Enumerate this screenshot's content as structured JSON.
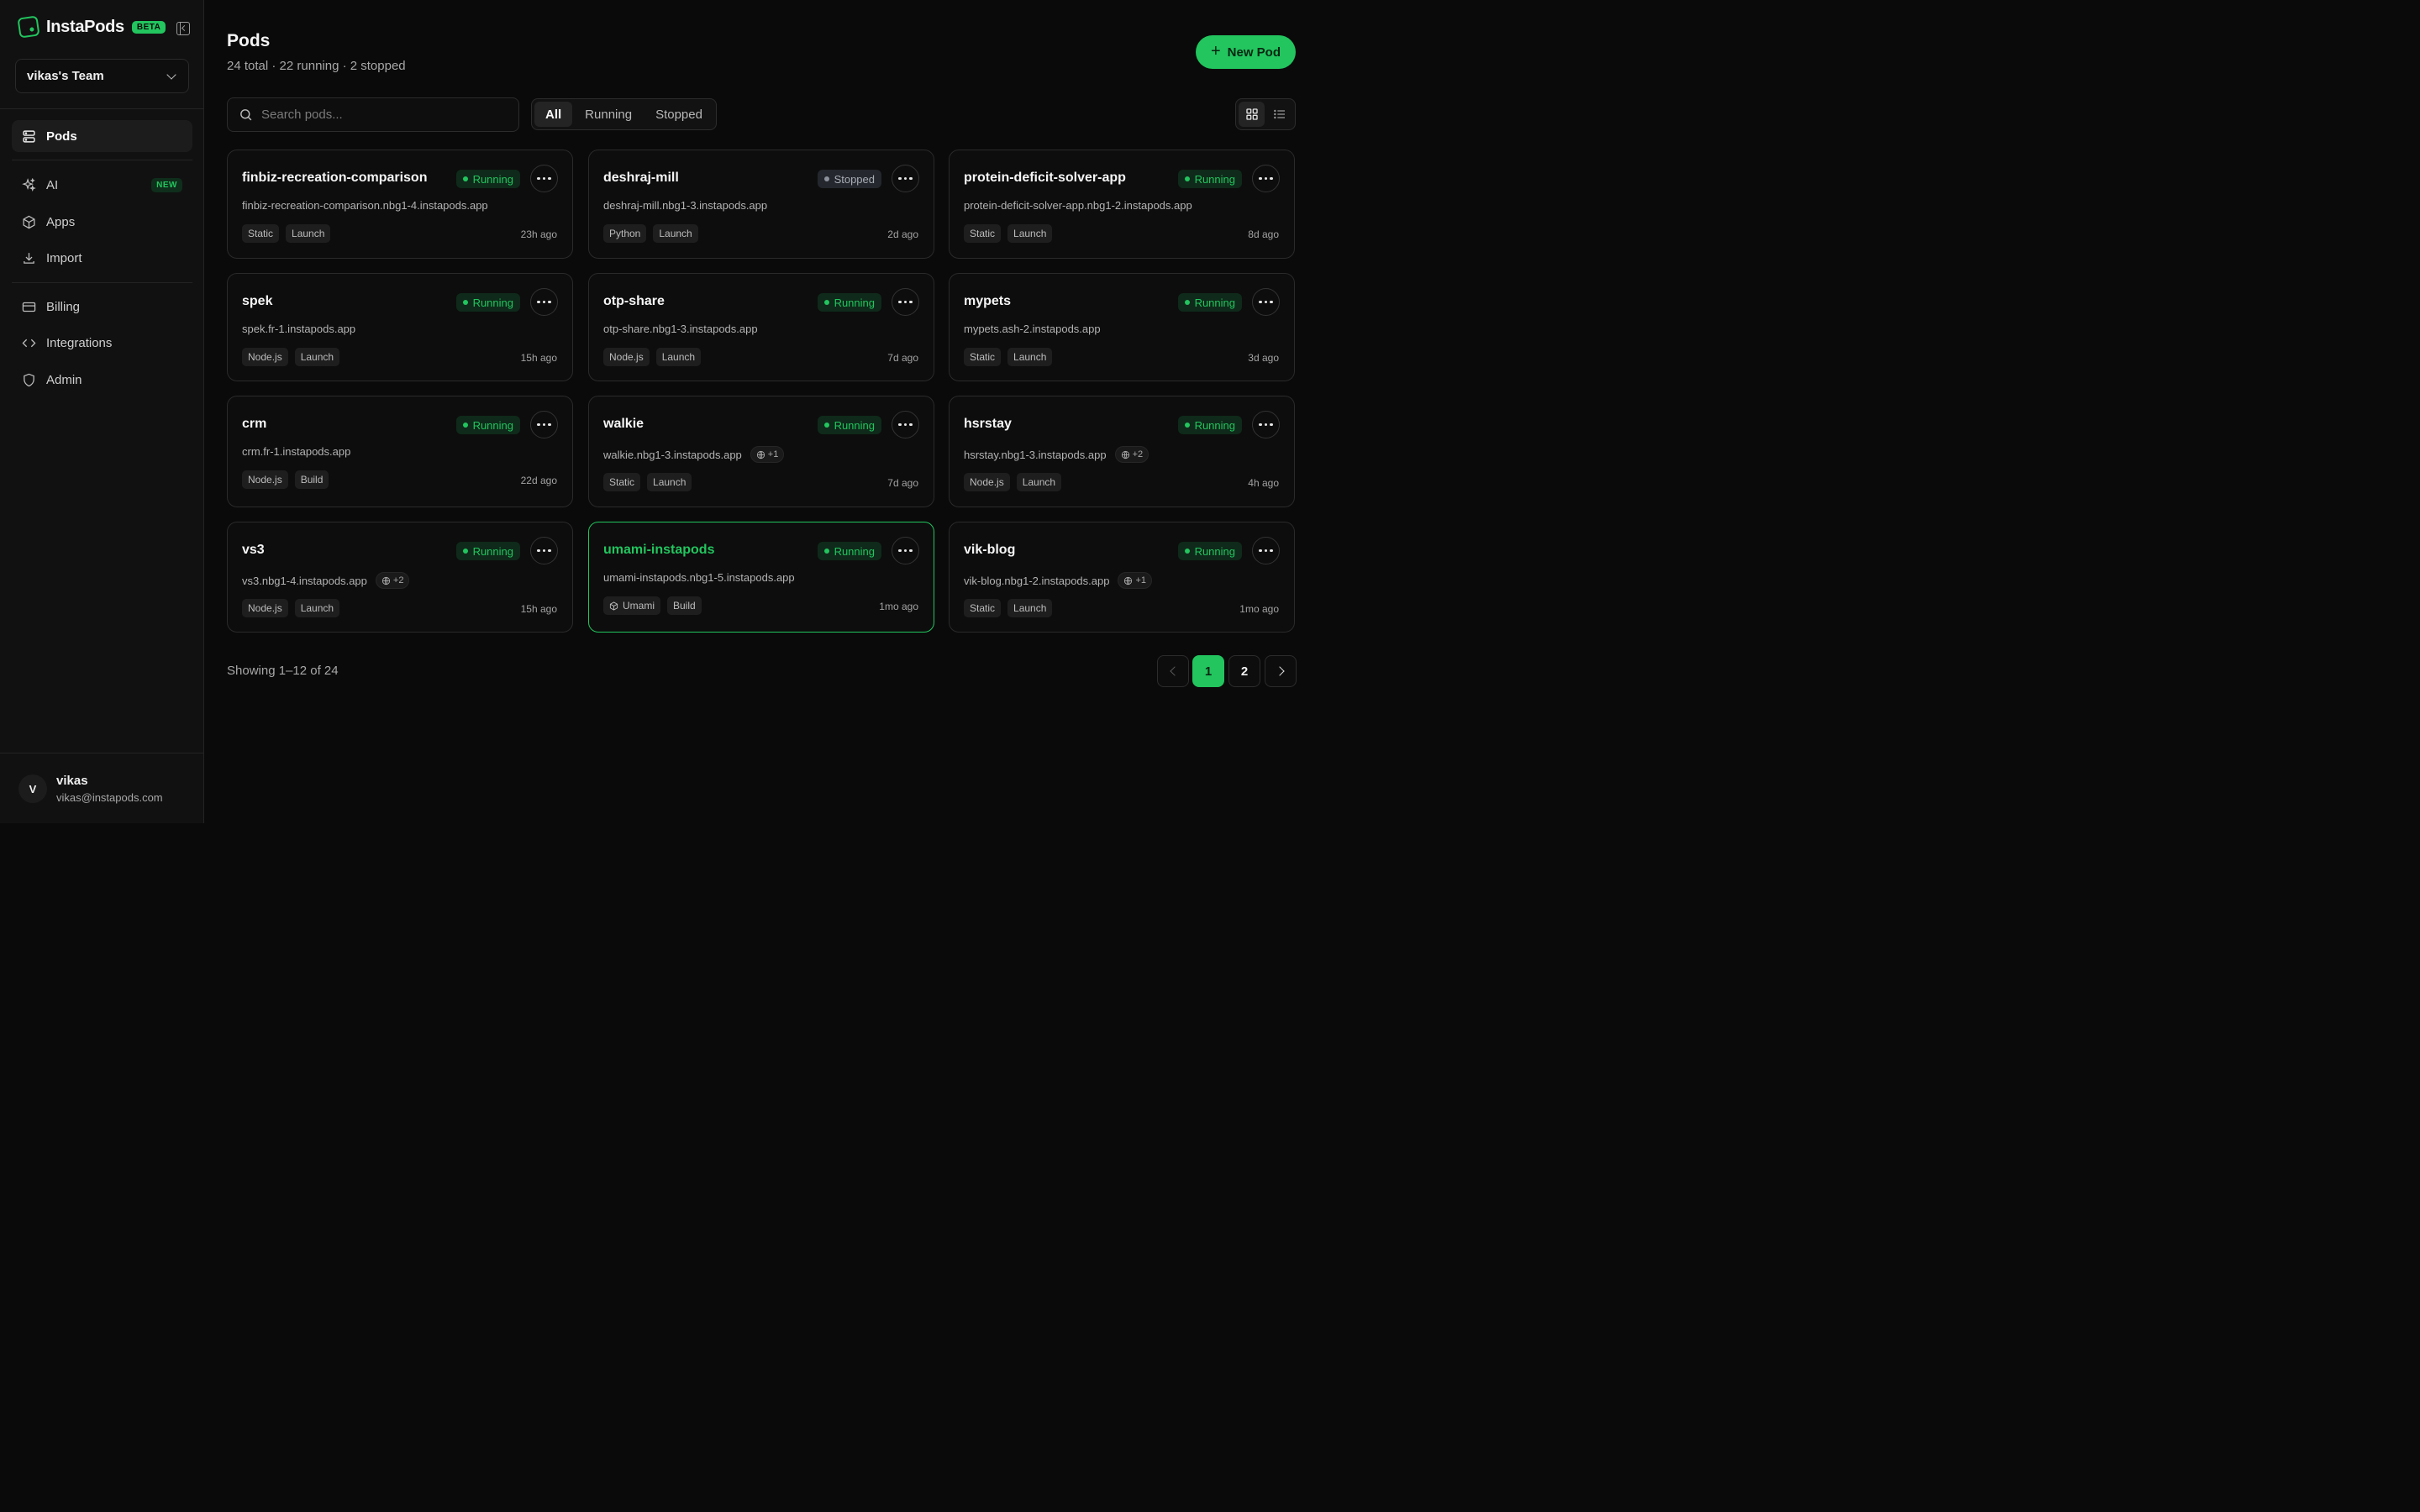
{
  "brand": {
    "name": "InstaPods",
    "badge": "BETA"
  },
  "team": {
    "label": "vikas's Team"
  },
  "nav": {
    "pods": "Pods",
    "ai": "AI",
    "ai_badge": "NEW",
    "apps": "Apps",
    "import": "Import",
    "billing": "Billing",
    "integrations": "Integrations",
    "admin": "Admin"
  },
  "user": {
    "initial": "V",
    "name": "vikas",
    "email": "vikas@instapods.com"
  },
  "header": {
    "title": "Pods",
    "subtitle": "24 total · 22 running · 2 stopped",
    "new_pod_label": "New Pod"
  },
  "search": {
    "placeholder": "Search pods...",
    "value": ""
  },
  "filters": [
    "All",
    "Running",
    "Stopped"
  ],
  "active_filter": "All",
  "colors": {
    "accent": "#22c55e",
    "stopped": "#8c919b",
    "background": "#0a0a0a"
  },
  "pods": [
    {
      "name": "finbiz-recreation-comparison",
      "status": "Running",
      "url": "finbiz-recreation-comparison.nbg1-4.instapods.app",
      "tags": [
        "Static",
        "Launch"
      ],
      "updated": "23h ago"
    },
    {
      "name": "deshraj-mill",
      "status": "Stopped",
      "url": "deshraj-mill.nbg1-3.instapods.app",
      "tags": [
        "Python",
        "Launch"
      ],
      "updated": "2d ago"
    },
    {
      "name": "protein-deficit-solver-app",
      "status": "Running",
      "url": "protein-deficit-solver-app.nbg1-2.instapods.app",
      "tags": [
        "Static",
        "Launch"
      ],
      "updated": "8d ago"
    },
    {
      "name": "spek",
      "status": "Running",
      "url": "spek.fr-1.instapods.app",
      "tags": [
        "Node.js",
        "Launch"
      ],
      "updated": "15h ago"
    },
    {
      "name": "otp-share",
      "status": "Running",
      "url": "otp-share.nbg1-3.instapods.app",
      "tags": [
        "Node.js",
        "Launch"
      ],
      "updated": "7d ago"
    },
    {
      "name": "mypets",
      "status": "Running",
      "url": "mypets.ash-2.instapods.app",
      "tags": [
        "Static",
        "Launch"
      ],
      "updated": "3d ago"
    },
    {
      "name": "crm",
      "status": "Running",
      "url": "crm.fr-1.instapods.app",
      "tags": [
        "Node.js",
        "Build"
      ],
      "updated": "22d ago"
    },
    {
      "name": "walkie",
      "status": "Running",
      "url": "walkie.nbg1-3.instapods.app",
      "extra_domains": "+1",
      "tags": [
        "Static",
        "Launch"
      ],
      "updated": "7d ago"
    },
    {
      "name": "hsrstay",
      "status": "Running",
      "url": "hsrstay.nbg1-3.instapods.app",
      "extra_domains": "+2",
      "tags": [
        "Node.js",
        "Launch"
      ],
      "updated": "4h ago"
    },
    {
      "name": "vs3",
      "status": "Running",
      "url": "vs3.nbg1-4.instapods.app",
      "extra_domains": "+2",
      "tags": [
        "Node.js",
        "Launch"
      ],
      "updated": "15h ago"
    },
    {
      "name": "umami-instapods",
      "status": "Running",
      "url": "umami-instapods.nbg1-5.instapods.app",
      "tags": [
        "Umami",
        "Build"
      ],
      "tag_icon": "cube-icon",
      "updated": "1mo ago",
      "highlighted": true
    },
    {
      "name": "vik-blog",
      "status": "Running",
      "url": "vik-blog.nbg1-2.instapods.app",
      "extra_domains": "+1",
      "tags": [
        "Static",
        "Launch"
      ],
      "updated": "1mo ago"
    }
  ],
  "pagination": {
    "showing": "Showing 1–12 of 24",
    "pages": [
      "1",
      "2"
    ],
    "current": "1"
  }
}
